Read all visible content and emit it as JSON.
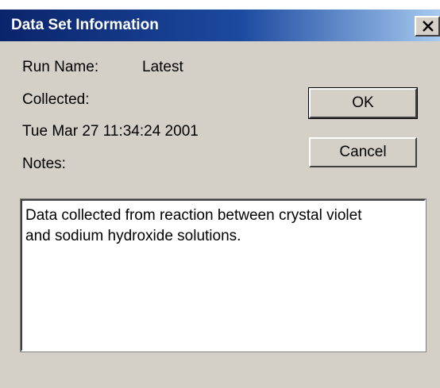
{
  "window": {
    "title": "Data Set Information",
    "close_glyph": "✕"
  },
  "fields": {
    "run_name_label": "Run Name:",
    "run_name_value": "Latest",
    "collected_label": "Collected:",
    "collected_value": "Tue Mar 27 11:34:24 2001",
    "notes_label": "Notes:"
  },
  "buttons": {
    "ok_label": "OK",
    "cancel_label": "Cancel"
  },
  "notes": {
    "text": "Data collected from reaction between crystal violet\nand sodium hydroxide solutions."
  },
  "colors": {
    "titlebar_start": "#0a246a",
    "titlebar_end": "#a6caf0",
    "dialog_face": "#d4d0c8"
  }
}
